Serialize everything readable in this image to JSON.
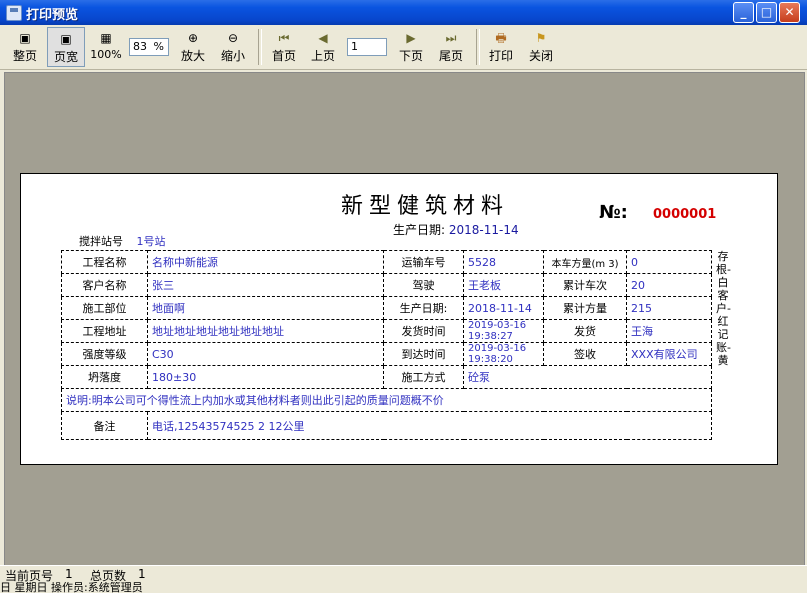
{
  "window": {
    "title": "打印预览"
  },
  "toolbar": {
    "whole_page": "整页",
    "page_width": "页宽",
    "hundred": "100%",
    "zoom_value": "83",
    "zoom_unit": "%",
    "zoom_in": "放大",
    "zoom_out": "缩小",
    "first_page": "首页",
    "prev_page": "上页",
    "page_number": "1",
    "next_page": "下页",
    "last_page": "尾页",
    "print": "打印",
    "close": "关闭"
  },
  "document": {
    "title": "新型健筑材料",
    "prod_date_label": "生产日期:",
    "prod_date_value": "2018-11-14",
    "no_label": "№:",
    "no_value": "0000001",
    "station_label": "搅拌站号",
    "station_value": "1号站",
    "rows": {
      "project_name_label": "工程名称",
      "project_name_value": "名称中新能源",
      "vehicle_no_label": "运输车号",
      "vehicle_no_value": "5528",
      "volume_label": "本车方量(m 3)",
      "volume_value": "0",
      "customer_label": "客户名称",
      "customer_value": "张三",
      "driver_label": "驾驶",
      "driver_value": "王老板",
      "total_trips_label": "累计车次",
      "total_trips_value": "20",
      "site_label": "施工部位",
      "site_value": "地面啊",
      "prod_date2_label": "生产日期:",
      "prod_date2_value": "2018-11-14",
      "total_volume_label": "累计方量",
      "total_volume_value": "215",
      "address_label": "工程地址",
      "address_value": "地址地址地址地址地址地址",
      "depart_label": "发货时间",
      "depart_value": "2019-03-16 19:38:27",
      "shipper_label": "发货",
      "shipper_value": "王海",
      "strength_label": "强度等级",
      "strength_value": "C30",
      "arrive_label": "到达时间",
      "arrive_value": "2019-03-16 19:38:20",
      "receive_label": "签收",
      "receive_value": "XXX有限公司",
      "slump_label": "坍落度",
      "slump_value": "180±30",
      "method_label": "施工方式",
      "method_value": "砼泵",
      "note_text": "说明:明本公司可个得性流上内加水或其他材料者则出此引起的质量问题概不价",
      "remark_label": "备注",
      "remark_value": "电话,12543574525 2 12公里"
    },
    "side_text": "存根-白 客户-红 记账-黄"
  },
  "status": {
    "current_page_label": "当前页号",
    "current_page_value": "1",
    "total_pages_label": "总页数",
    "total_pages_value": "1"
  },
  "bottom_text": "日 星期日 操作员:系统管理员"
}
